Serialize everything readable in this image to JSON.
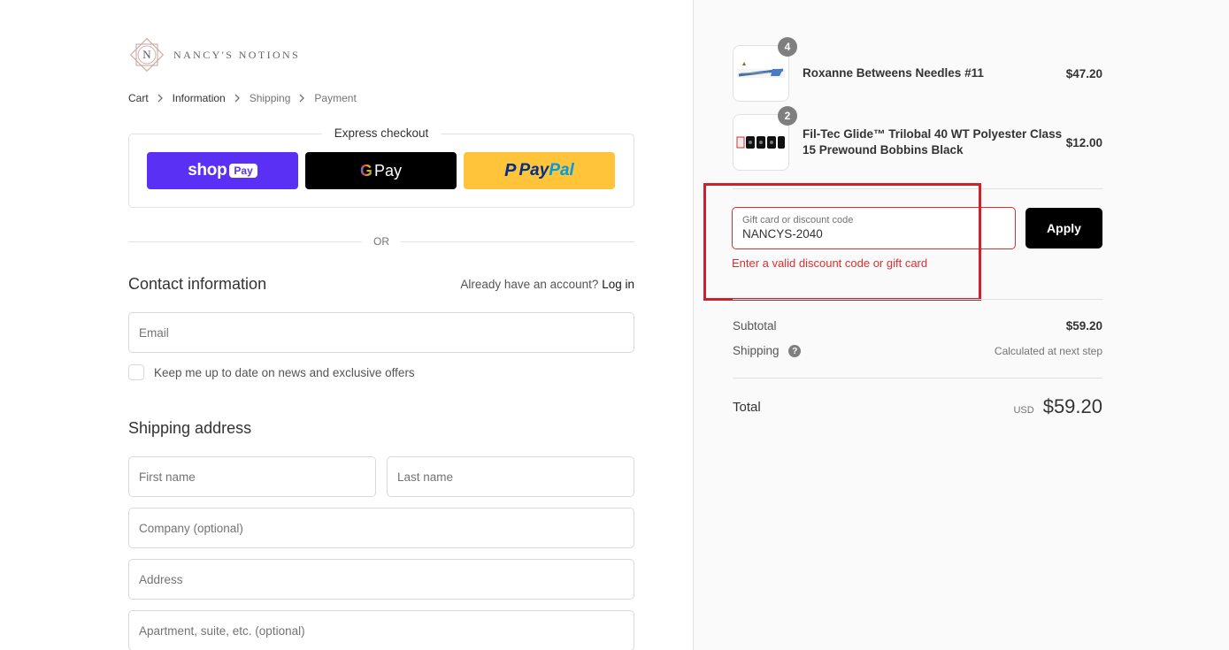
{
  "brand": {
    "name": "NANCY'S NOTIONS",
    "monogram": "N"
  },
  "breadcrumb": [
    {
      "label": "Cart"
    },
    {
      "label": "Information"
    },
    {
      "label": "Shipping"
    },
    {
      "label": "Payment"
    }
  ],
  "express": {
    "title": "Express checkout",
    "shop_label": "shop",
    "shop_pay_badge": "Pay",
    "gpay_g": "G",
    "gpay_label": "Pay",
    "paypal_p": "P",
    "paypal_pay": "Pay",
    "paypal_pal": "Pal"
  },
  "or_label": "OR",
  "contact": {
    "title": "Contact information",
    "account_prompt": "Already have an account?",
    "login_label": "Log in",
    "email_placeholder": "Email",
    "newsletter_label": "Keep me up to date on news and exclusive offers"
  },
  "shipping": {
    "title": "Shipping address",
    "first_name_placeholder": "First name",
    "last_name_placeholder": "Last name",
    "company_placeholder": "Company (optional)",
    "address_placeholder": "Address",
    "apartment_placeholder": "Apartment, suite, etc. (optional)"
  },
  "cart": {
    "items": [
      {
        "name": "Roxanne Betweens Needles #11",
        "quantity": "4",
        "price": "$47.20"
      },
      {
        "name": "Fil-Tec Glide™ Trilobal 40 WT Polyester Class 15 Prewound Bobbins Black",
        "quantity": "2",
        "price": "$12.00"
      }
    ]
  },
  "discount": {
    "label": "Gift card or discount code",
    "value": "NANCYS-2040",
    "apply_label": "Apply",
    "error": "Enter a valid discount code or gift card"
  },
  "summary": {
    "subtotal_label": "Subtotal",
    "subtotal_value": "$59.20",
    "shipping_label": "Shipping",
    "shipping_help": "?",
    "shipping_value": "Calculated at next step",
    "total_label": "Total",
    "currency": "USD",
    "total_value": "$59.20"
  },
  "colors": {
    "shop_pay": "#5a31f4",
    "gpay": "#000000",
    "paypal": "#ffc439",
    "error": "#e32c2b",
    "highlight": "#d0202b"
  }
}
